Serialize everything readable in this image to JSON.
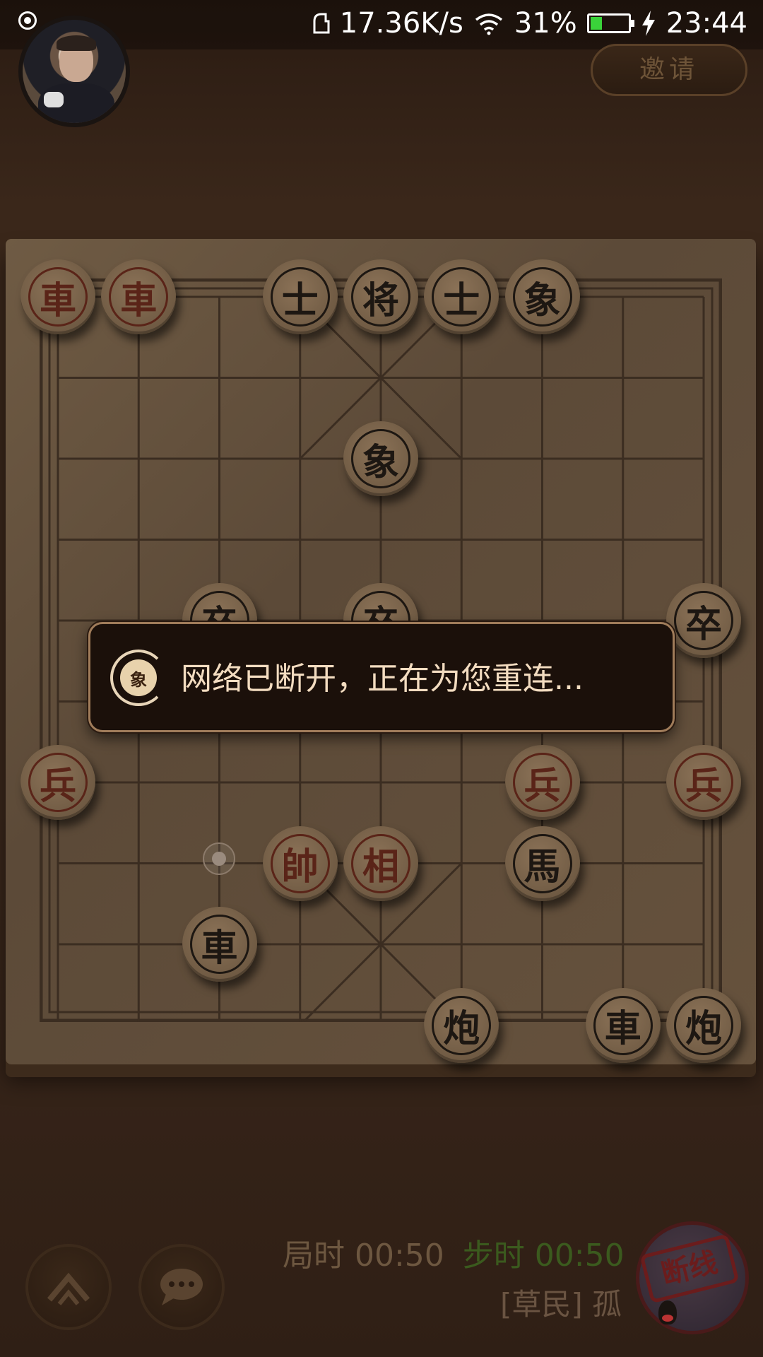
{
  "status_bar": {
    "speed": "17.36K/s",
    "battery_percent": "31%",
    "battery_level": 0.31,
    "time": "23:44",
    "icons": [
      "record-icon",
      "more-dots-icon",
      "speed-icon",
      "wifi-icon",
      "battery-icon",
      "charging-icon"
    ]
  },
  "header": {
    "invite_label": "邀请"
  },
  "board": {
    "pieces": [
      {
        "char": "車",
        "side": "red"
      },
      {
        "char": "車",
        "side": "red"
      },
      {
        "char": "士",
        "side": "black"
      },
      {
        "char": "将",
        "side": "black"
      },
      {
        "char": "士",
        "side": "black"
      },
      {
        "char": "象",
        "side": "black"
      },
      {
        "char": "象",
        "side": "black"
      },
      {
        "char": "卒",
        "side": "black"
      },
      {
        "char": "卒",
        "side": "black"
      },
      {
        "char": "卒",
        "side": "black"
      },
      {
        "char": "兵",
        "side": "red"
      },
      {
        "char": "兵",
        "side": "red"
      },
      {
        "char": "兵",
        "side": "red"
      },
      {
        "char": "帥",
        "side": "red"
      },
      {
        "char": "相",
        "side": "red"
      },
      {
        "char": "馬",
        "side": "black"
      },
      {
        "char": "車",
        "side": "black"
      },
      {
        "char": "炮",
        "side": "black"
      },
      {
        "char": "車",
        "side": "black"
      },
      {
        "char": "炮",
        "side": "black"
      }
    ]
  },
  "toast": {
    "icon_char": "象",
    "message": "网络已断开，正在为您重连..."
  },
  "footer": {
    "game_time": "局时 00:50",
    "step_time": "步时 00:50",
    "player_name": "[草民] 孤",
    "stamp": "断线"
  },
  "colors": {
    "red_piece_text": "#5a2418",
    "black_piece_text": "#1d1712",
    "toast_text": "#f3dcc0",
    "step_timer": "#3b5a1e"
  }
}
